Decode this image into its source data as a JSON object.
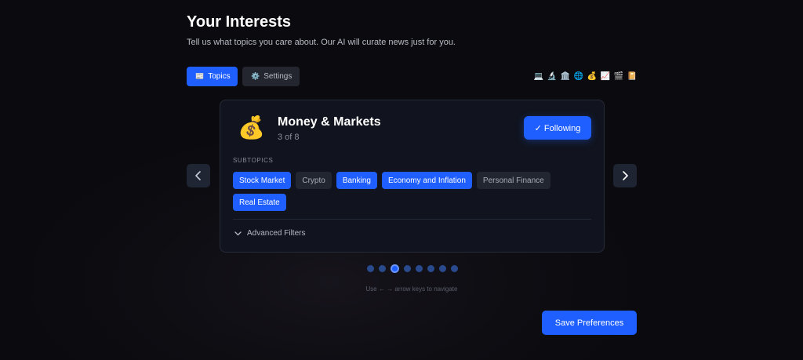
{
  "header": {
    "title": "Your Interests",
    "subtitle": "Tell us what topics you care about. Our AI will curate news just for you."
  },
  "tabs": [
    {
      "label": "Topics",
      "icon": "newspaper-icon",
      "glyph": "📰",
      "active": true
    },
    {
      "label": "Settings",
      "icon": "gear-icon",
      "glyph": "⚙️",
      "active": false
    }
  ],
  "quick_topics": [
    {
      "icon": "laptop-icon",
      "glyph": "💻"
    },
    {
      "icon": "microscope-icon",
      "glyph": "🔬"
    },
    {
      "icon": "classical-building-icon",
      "glyph": "🏛️"
    },
    {
      "icon": "globe-icon",
      "glyph": "🌐"
    },
    {
      "icon": "money-bag-icon",
      "glyph": "💰"
    },
    {
      "icon": "chart-increasing-icon",
      "glyph": "📈"
    },
    {
      "icon": "clapper-board-icon",
      "glyph": "🎬"
    },
    {
      "icon": "book-icon",
      "glyph": "📔"
    }
  ],
  "card": {
    "icon": "money-bag-icon",
    "glyph": "💰",
    "title": "Money & Markets",
    "counter": "3 of 8",
    "follow_label": "✓ Following",
    "subtopics_label": "SUBTOPICS",
    "subtopics": [
      {
        "label": "Stock Market",
        "selected": true
      },
      {
        "label": "Crypto",
        "selected": false
      },
      {
        "label": "Banking",
        "selected": true
      },
      {
        "label": "Economy and Inflation",
        "selected": true
      },
      {
        "label": "Personal Finance",
        "selected": false
      },
      {
        "label": "Real Estate",
        "selected": true
      }
    ],
    "advanced_label": "Advanced Filters"
  },
  "pagination": {
    "total": 8,
    "current": 3
  },
  "hint": "Use ← → arrow keys to navigate",
  "save_label": "Save Preferences",
  "colors": {
    "accent": "#1f5fff",
    "background": "#0b0b0f",
    "card": "#11141e"
  }
}
